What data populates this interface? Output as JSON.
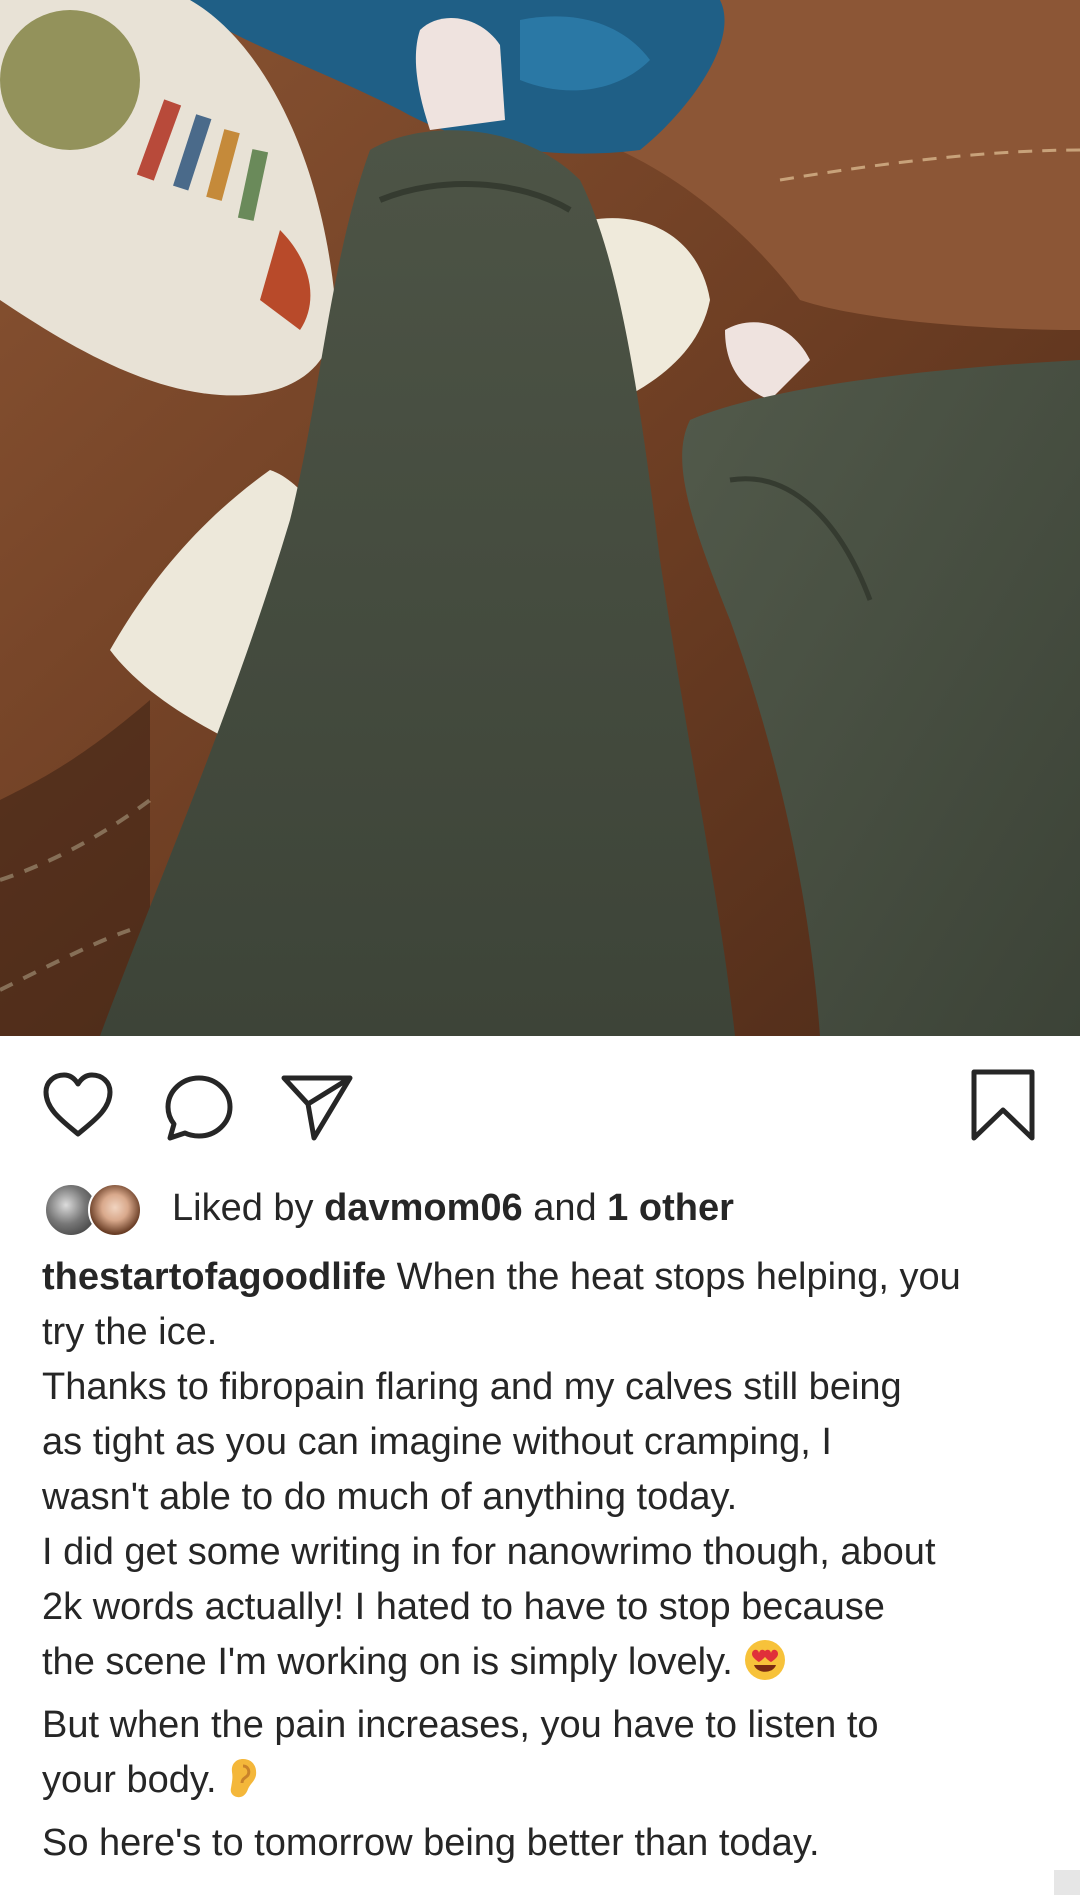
{
  "post": {
    "image_alt": "Legs in grey sweatpants resting on a brown leather couch with an ice towel",
    "actions": {
      "like": "heart-icon",
      "comment": "comment-icon",
      "share": "share-icon",
      "save": "bookmark-icon"
    },
    "likes": {
      "prefix": "Liked by ",
      "user": "davmom06",
      "middle": " and ",
      "others": "1 other"
    },
    "caption": {
      "username": "thestartofagoodlife",
      "lines": [
        " When the heat stops helping,  you",
        "try the ice.",
        "Thanks to fibropain flaring and my calves still being",
        "as tight as you can imagine without cramping,  I",
        "wasn't able to do much of anything today.",
        "I did get some writing in for nanowrimo though, about",
        "2k words actually! I hated to have to stop because",
        "the scene I'm working on is simply lovely. ",
        "But when the pain increases, you have to listen to",
        "your body. ",
        "So here's to tomorrow being better than today."
      ],
      "emoji_heart_eyes": "😍",
      "emoji_ear": "👂"
    }
  }
}
